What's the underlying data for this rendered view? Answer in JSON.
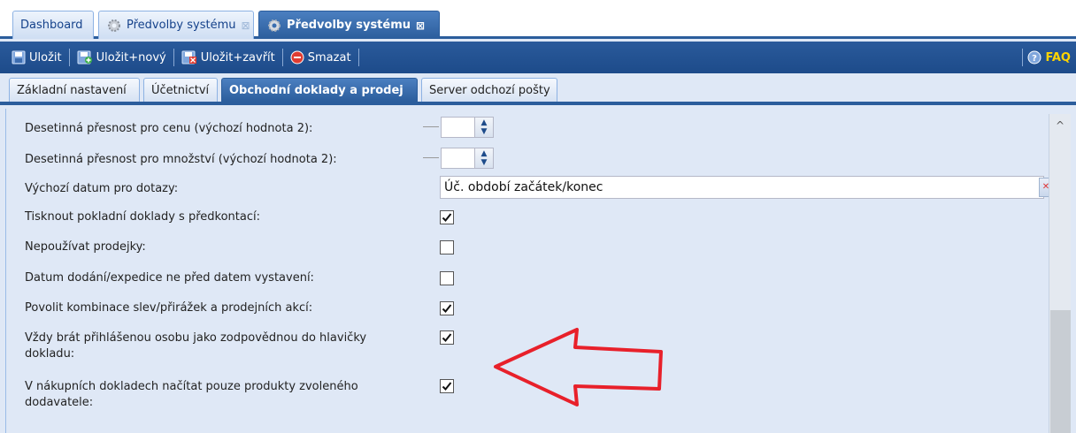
{
  "top_tabs": [
    {
      "label": "Dashboard"
    },
    {
      "label": "Předvolby systému"
    },
    {
      "label": "Předvolby systému"
    }
  ],
  "toolbar": {
    "save": "Uložit",
    "save_new": "Uložit+nový",
    "save_close": "Uložit+zavřít",
    "delete": "Smazat",
    "faq": "FAQ"
  },
  "sub_tabs": [
    {
      "label": "Základní nastavení"
    },
    {
      "label": "Účetnictví"
    },
    {
      "label": "Obchodní doklady a prodej"
    },
    {
      "label": "Server odchozí pošty"
    }
  ],
  "form": {
    "price_precision_label": "Desetinná přesnost pro cenu (výchozí hodnota 2):",
    "qty_precision_label": "Desetinná přesnost pro množství (výchozí hodnota 2):",
    "default_date_label": "Výchozí datum pro dotazy:",
    "default_date_value": "Úč. období začátek/konec",
    "print_cash_label": "Tisknout pokladní doklady s předkontací:",
    "no_receipts_label": "Nepoužívat prodejky:",
    "delivery_date_label": "Datum dodání/expedice ne před datem vystavení:",
    "allow_combo_label": "Povolit kombinace slev/přirážek a prodejních akcí:",
    "responsible_label_1": "Vždy brát přihlášenou osobu jako zodpovědnou do hlavičky",
    "responsible_label_2": "dokladu:",
    "supplier_label_1": "V nákupních dokladech načítat pouze produkty zvoleného",
    "supplier_label_2": "dodavatele:"
  },
  "checkboxes": {
    "print_cash": true,
    "no_receipts": false,
    "delivery_date": false,
    "allow_combo": true,
    "responsible": true,
    "supplier": true
  },
  "colors": {
    "accent": "#2b5d9c",
    "arrow": "#e8202a",
    "faq": "#ffd400"
  }
}
